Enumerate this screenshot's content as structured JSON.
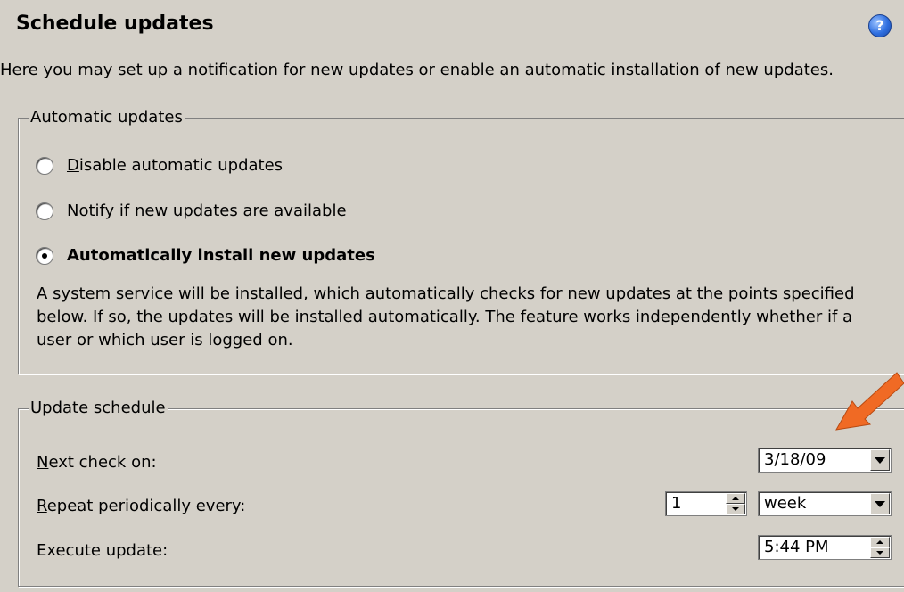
{
  "header": {
    "title": "Schedule updates",
    "help_icon_glyph": "?"
  },
  "description": "Here you may set up a notification for new updates or enable an automatic installation of new updates.",
  "automatic_updates": {
    "legend": "Automatic updates",
    "options": [
      {
        "mnemonic": "D",
        "label_rest": "isable automatic updates",
        "checked": false
      },
      {
        "label": "Notify if new updates are available",
        "checked": false
      },
      {
        "label": "Automatically install new updates",
        "checked": true
      }
    ],
    "info": "A system service will be installed, which automatically checks for new updates at the points specified below. If so, the updates will be installed automatically. The feature works independently whether if a user or which user is logged on."
  },
  "update_schedule": {
    "legend": "Update schedule",
    "next_check": {
      "mnemonic": "N",
      "label_rest": "ext check on:",
      "value": "3/18/09"
    },
    "repeat": {
      "mnemonic": "R",
      "label_rest": "epeat periodically every:",
      "count": "1",
      "unit": "week"
    },
    "execute": {
      "label": "Execute update:",
      "time": "5:44 PM"
    }
  },
  "colors": {
    "background": "#d4d0c8",
    "arrow": "#f06a24"
  }
}
